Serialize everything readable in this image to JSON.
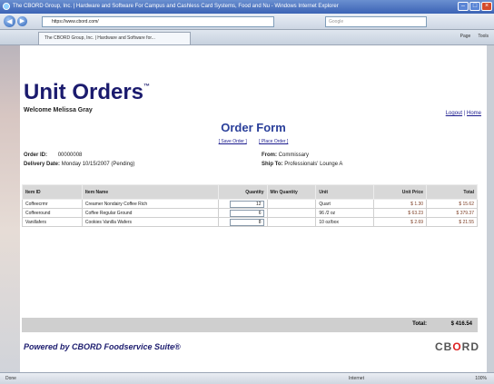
{
  "browser": {
    "window_title": "The CBORD Group, Inc. | Hardware and Software For Campus and Cashless Card Systems, Food and Nu - Windows Internet Explorer",
    "url": "https://www.cbord.com/",
    "search_placeholder": "Google",
    "tab_title": "The CBORD Group, Inc. | Hardware and Software for...",
    "toolbar": [
      "Page",
      "Tools"
    ],
    "status_left": "Done",
    "status_zone": "Internet",
    "status_zoom": "100%"
  },
  "app": {
    "title": "Unit Orders",
    "trademark": "™",
    "welcome": "Welcome Melissa Gray",
    "logout": "Logout",
    "home": "Home",
    "separator": "|"
  },
  "form": {
    "title": "Order Form",
    "save_order": "[ Save Order ]",
    "place_order": "[ Place Order ]",
    "order_id_label": "Order ID:",
    "order_id_value": "00000008",
    "delivery_label": "Delivery Date:",
    "delivery_value": "Monday 10/15/2007 (Pending)",
    "from_label": "From:",
    "from_value": "Commissary",
    "shipto_label": "Ship To:",
    "shipto_value": "Professionals' Lounge A"
  },
  "table": {
    "headers": [
      "Item ID",
      "Item Name",
      "Quantity",
      "Min Quantity",
      "Unit",
      "Unit Price",
      "Total"
    ],
    "rows": [
      {
        "id": "Coffeecrmr",
        "name": "Creamer Nondairy Coffee Rich",
        "qty": "12",
        "min": "",
        "unit": "Quart",
        "price": "$ 1.30",
        "total": "$ 15.62"
      },
      {
        "id": "Coffeeround",
        "name": "Coffee Regular Ground",
        "qty": "6",
        "min": "",
        "unit": "96 /2 oz",
        "price": "$ 63.23",
        "total": "$ 379.37"
      },
      {
        "id": "Vanillafers",
        "name": "Cookies Vanilla Wafers",
        "qty": "8",
        "min": "",
        "unit": "10 oz/box",
        "price": "$ 2.69",
        "total": "$ 21.55"
      }
    ],
    "total_label": "Total:",
    "total_value": "$ 416.54"
  },
  "footer": {
    "powered_by": "Powered by CBORD Foodservice Suite®",
    "logo_a": "CB",
    "logo_b": "O",
    "logo_c": "RD"
  }
}
